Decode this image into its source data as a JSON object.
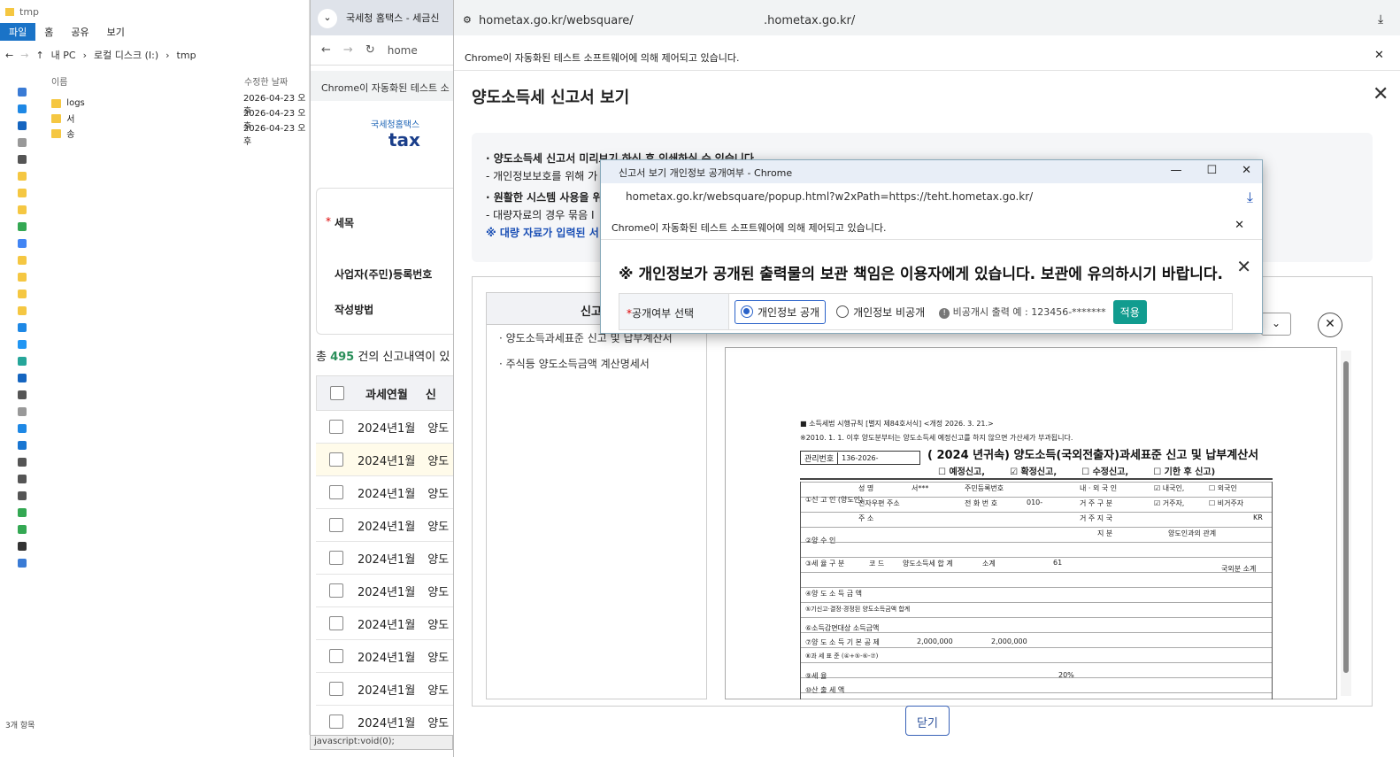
{
  "explorer": {
    "qat_text": "tmp",
    "ribbon": [
      "파일",
      "홈",
      "공유",
      "보기"
    ],
    "breadcrumb": [
      "내 PC",
      "로컬 디스크 (I:)",
      "tmp"
    ],
    "col_name": "이름",
    "col_modified": "수정한 날짜",
    "files": [
      {
        "name": "logs",
        "date": "2026-04-23 오후"
      },
      {
        "name": "서",
        "date": "2026-04-23 오후"
      },
      {
        "name": "송",
        "date": "2026-04-23 오후"
      }
    ],
    "status": "3개 항목"
  },
  "hometax": {
    "tab_title": "국세청 홈택스 - 세금신",
    "url": "home",
    "automation_bar": "Chrome이 자동화된 테스트 소",
    "logo_text": "국세청홈택스",
    "logo_sub": "tax",
    "label_subject": "세목",
    "label_regno": "사업자(주민)등록번호",
    "label_method": "작성방법",
    "count_prefix": "총 ",
    "count": "495",
    "count_suffix": " 건의 신고내역이 있",
    "col_period": "과세연월",
    "col_type": "신",
    "rows": [
      "2024년1월",
      "2024년1월",
      "2024년1월",
      "2024년1월",
      "2024년1월",
      "2024년1월",
      "2024년1월",
      "2024년1월",
      "2024년1월",
      "2024년1월"
    ],
    "row_type": "양도",
    "status_url": "javascript:void(0);"
  },
  "viewer": {
    "url": "hometax.go.kr/websquare/",
    "url_tail": ".hometax.go.kr/",
    "automation_bar": "Chrome이 자동화된 테스트 소프트웨어에 의해 제어되고 있습니다.",
    "title": "양도소득세 신고서 보기",
    "info": [
      "· 양도소득세 신고서 미리보기 하신 후 인쇄하실 수 있습니다.",
      "  - 개인정보보호를 위해 가",
      "· 원활한 시스템 사용을 위",
      "  - 대량자료의 경우 묶음 I",
      "※ 대량 자료가 입력된 서"
    ],
    "list_header": "신고서",
    "list_items": [
      "· 양도소득과세표준 신고 및 납부계산서",
      "· 주식등 양도소득금액 계산명세서"
    ],
    "close_button": "닫기"
  },
  "tax_form": {
    "rule": "■ 소득세법 시행규칙 [별지 제84호서식] <개정 2026. 3. 21.>",
    "note": "※2010. 1. 1. 이후 양도분부터는 양도소득세 예정신고를 하지 않으면 가산세가 부과됩니다.",
    "mgmt_label": "관리번호",
    "mgmt_value": "136-2026-",
    "year": "2024",
    "heading": "( 2024  년귀속) 양도소득(국외전출자)과세표준 신고 및 납부계산서",
    "types": [
      "예정신고,",
      "확정신고,",
      "수정신고,",
      "기한 후 신고)"
    ],
    "labels": [
      "①신 고 인 (양도인)",
      "성 명",
      "주민등록번호",
      "내 · 외 국 인",
      "내국인,",
      "외국인",
      "전자우편 주소",
      "전 화 번 호",
      "거 주 구 분",
      "거주자,",
      "비거주자",
      "주 소",
      "거 주 지 국",
      "KR",
      "②양 수 인",
      "지 분",
      "양도인과의 관계",
      "③세 율 구 분",
      "코 드",
      "양도소득세 합 계",
      "소계",
      "61",
      "국외분 소계",
      "④양 도 소 득 금 액",
      "⑤기신고·결정·경정된 양도소득금액 합계",
      "⑥소득감면대상 소득금액",
      "⑦양 도 소 득 기 본 공 제",
      "⑧과 세 표 준 (④+⑤-⑥-⑦)",
      "⑨세 율",
      "⑩산 출 세 액"
    ],
    "name_masked": "서***",
    "phone_masked": "010-",
    "values": [
      "2,000,000",
      "2,000,000",
      "20%"
    ]
  },
  "popup": {
    "window_title": "신고서 보기 개인정보 공개여부 - Chrome",
    "url": "hometax.go.kr/websquare/popup.html?w2xPath=https://teht.hometax.go.kr/",
    "automation_bar": "Chrome이 자동화된 테스트 소프트웨어에 의해 제어되고 있습니다.",
    "heading": "※ 개인정보가 공개된 출력물의 보관 책임은 이용자에게 있습니다. 보관에 유의하시기 바랍니다.",
    "field_label": "공개여부 선택",
    "option_public": "개인정보 공개",
    "option_private": "개인정보 비공개",
    "example": "비공개시 출력 예 : 123456-*******",
    "apply": "적용"
  }
}
